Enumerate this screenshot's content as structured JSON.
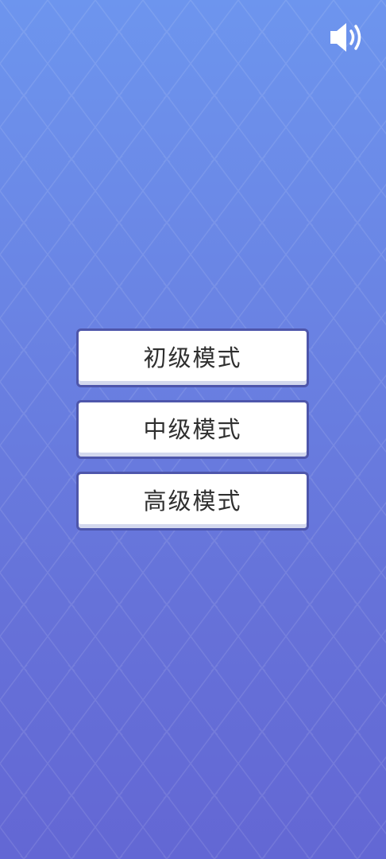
{
  "sound_toggle": {
    "icon": "speaker-icon",
    "state": "on"
  },
  "menu": {
    "buttons": [
      {
        "label": "初级模式"
      },
      {
        "label": "中级模式"
      },
      {
        "label": "高级模式"
      }
    ]
  },
  "colors": {
    "background_top": "#6d95ee",
    "background_bottom": "#6367d4",
    "button_fill": "#ffffff",
    "button_border": "#4e56ab",
    "button_text": "#2f2f2f"
  }
}
